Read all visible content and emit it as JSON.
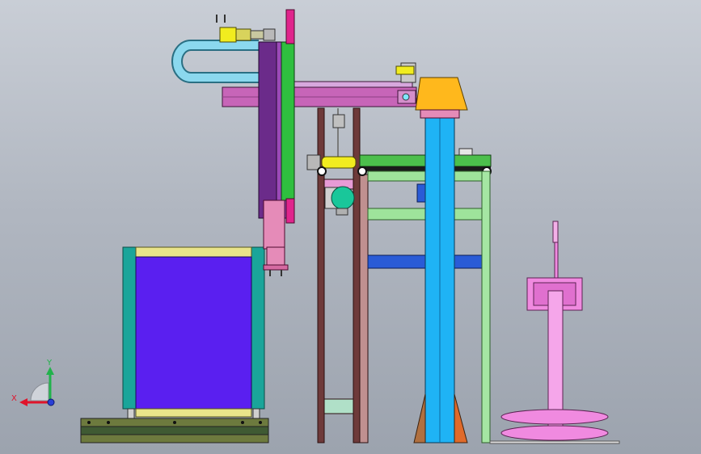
{
  "view": {
    "background_top": "#c9ced6",
    "background_bottom": "#9ca3ae"
  },
  "triad": {
    "x_label": "X",
    "y_label": "Y",
    "x_color": "#e0142b",
    "y_color": "#22b24c",
    "z_color": "#2a3fd6"
  },
  "palette": {
    "gantry_beam": "#c765b8",
    "column_purple": "#6b2b8a",
    "column_green": "#2fbf3f",
    "magenta": "#e0248c",
    "pink_part": "#e58bb8",
    "cable_chain": "#8bd8ee",
    "motor_yellow": "#f1ec1f",
    "bin_fill": "#5a1ff0",
    "bin_frame": "#1aa59a",
    "bin_trim": "#e9e48a",
    "base": "#4e6b3b",
    "blue_column": "#1fb3f5",
    "hopper": "#ffb81c",
    "teal_motor": "#19c79a",
    "light_green_frame": "#9ee39b",
    "blue_strip": "#2a5bd6",
    "brown_frame": "#6e3a3a",
    "spool_pink": "#f08ae0"
  }
}
